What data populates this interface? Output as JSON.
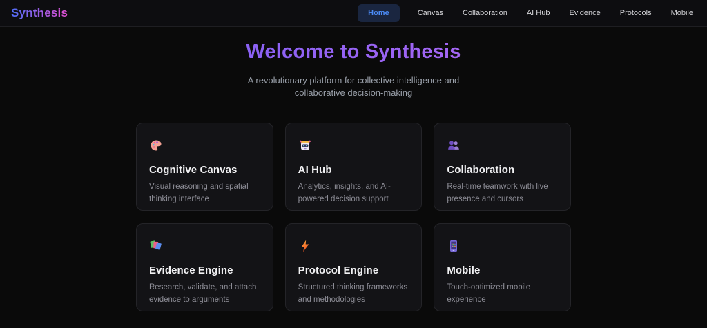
{
  "brand": {
    "logo": "Synthesis"
  },
  "nav": {
    "items": [
      {
        "label": "Home",
        "active": true
      },
      {
        "label": "Canvas",
        "active": false
      },
      {
        "label": "Collaboration",
        "active": false
      },
      {
        "label": "AI Hub",
        "active": false
      },
      {
        "label": "Evidence",
        "active": false
      },
      {
        "label": "Protocols",
        "active": false
      },
      {
        "label": "Mobile",
        "active": false
      }
    ]
  },
  "hero": {
    "title": "Welcome to Synthesis",
    "subtitle": "A revolutionary platform for collective intelligence and collaborative decision-making"
  },
  "cards": [
    {
      "icon": "palette-icon",
      "title": "Cognitive Canvas",
      "description": "Visual reasoning and spatial thinking interface"
    },
    {
      "icon": "robot-icon",
      "title": "AI Hub",
      "description": "Analytics, insights, and AI-powered decision support"
    },
    {
      "icon": "people-icon",
      "title": "Collaboration",
      "description": "Real-time teamwork with live presence and cursors"
    },
    {
      "icon": "books-icon",
      "title": "Evidence Engine",
      "description": "Research, validate, and attach evidence to arguments"
    },
    {
      "icon": "bolt-icon",
      "title": "Protocol Engine",
      "description": "Structured thinking frameworks and methodologies"
    },
    {
      "icon": "phone-icon",
      "title": "Mobile",
      "description": "Touch-optimized mobile experience"
    }
  ],
  "colors": {
    "background": "#0a0a0a",
    "header_bg": "#0d0d10",
    "card_bg": "#131316",
    "card_border": "#242428",
    "accent_blue": "#4b8bf5",
    "nav_active_bg": "#1a2640",
    "logo_gradient_start": "#4f6cf7",
    "logo_gradient_end": "#e44fd3",
    "hero_gradient_start": "#6d5cf6",
    "hero_gradient_end": "#c16bf2",
    "text_muted": "#9aa0aa"
  }
}
